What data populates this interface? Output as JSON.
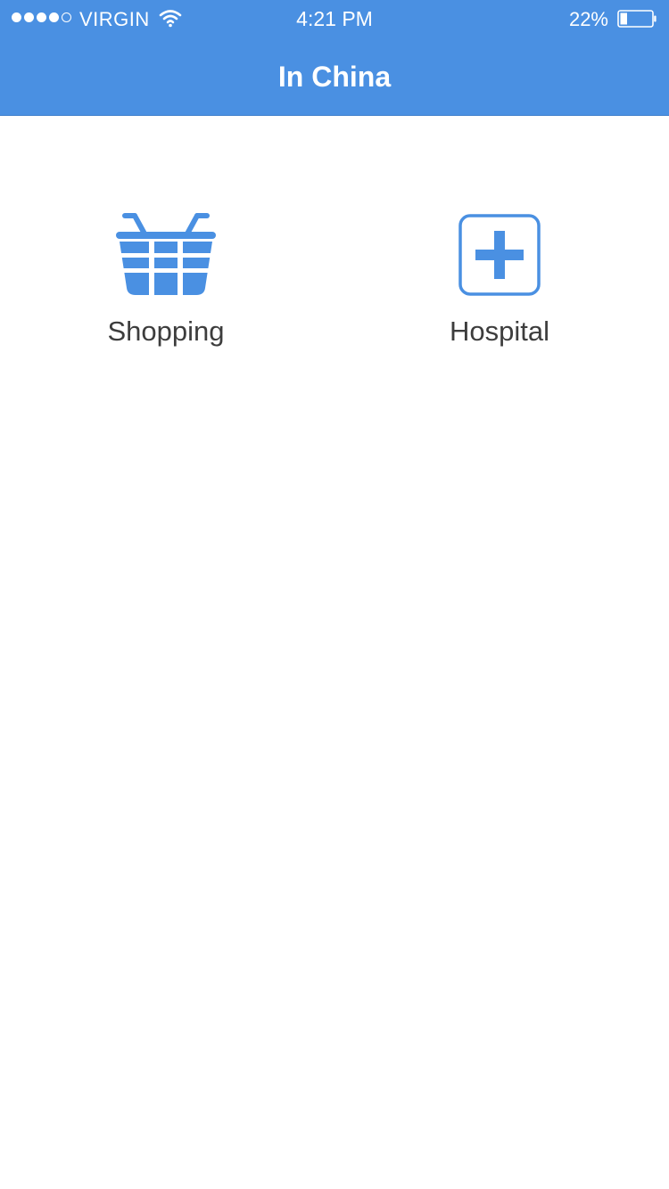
{
  "status_bar": {
    "carrier": "VIRGIN",
    "time": "4:21 PM",
    "battery_percent": "22%",
    "battery_level": 0.22,
    "signal_bars_filled": 4,
    "signal_bars_total": 5
  },
  "header": {
    "title": "In China"
  },
  "menu": {
    "items": [
      {
        "label": "Shopping",
        "icon": "basket-icon"
      },
      {
        "label": "Hospital",
        "icon": "medical-cross-icon"
      }
    ]
  },
  "colors": {
    "primary": "#4a90e2",
    "text": "#3d3d3d",
    "background": "#ffffff"
  }
}
